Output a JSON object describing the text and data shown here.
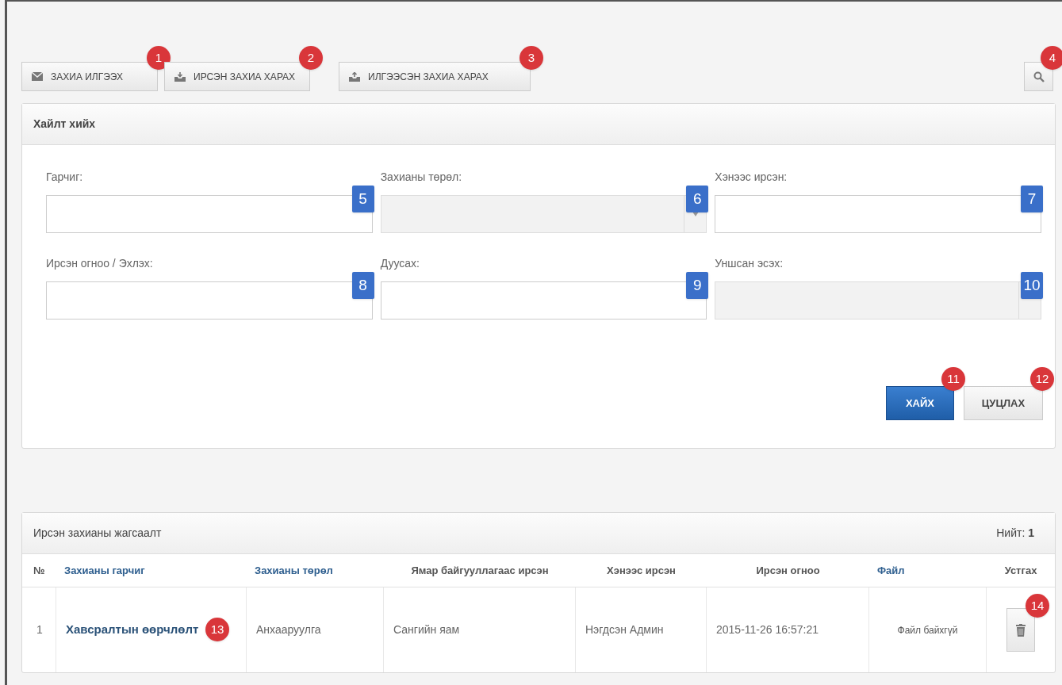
{
  "toolbar": [
    {
      "label": "ЗАХИА ИЛГЭЭХ",
      "marker": "1"
    },
    {
      "label": "ИРСЭН ЗАХИА ХАРАХ",
      "marker": "2"
    },
    {
      "label": "ИЛГЭЭСЭН ЗАХИА ХАРАХ",
      "marker": "3"
    }
  ],
  "search_toggle": {
    "marker": "4"
  },
  "search_panel": {
    "title": "Хайлт хийх",
    "fields": [
      {
        "label": "Гарчиг:",
        "kind": "text",
        "marker": "5"
      },
      {
        "label": "Захианы төрөл:",
        "kind": "select",
        "marker": "6"
      },
      {
        "label": "Хэнээс ирсэн:",
        "kind": "text",
        "marker": "7"
      },
      {
        "label": "Ирсэн огноо / Эхлэх:",
        "kind": "text",
        "marker": "8"
      },
      {
        "label": "Дуусах:",
        "kind": "text",
        "marker": "9"
      },
      {
        "label": "Уншсан эсэх:",
        "kind": "addon",
        "marker": "10"
      }
    ],
    "buttons": [
      {
        "label": "ХАЙХ",
        "kind": "primary",
        "marker": "11"
      },
      {
        "label": "ЦУЦЛАХ",
        "kind": "default",
        "marker": "12"
      }
    ]
  },
  "list_panel": {
    "title": "Ирсэн захианы жагсаалт",
    "total_label": "Нийт:",
    "total": "1",
    "columns": [
      {
        "label": "№",
        "sortable": false
      },
      {
        "label": "Захианы гарчиг",
        "sortable": true
      },
      {
        "label": "Захианы төрөл",
        "sortable": true
      },
      {
        "label": "Ямар байгууллагаас ирсэн",
        "sortable": false
      },
      {
        "label": "Хэнээс ирсэн",
        "sortable": false
      },
      {
        "label": "Ирсэн огноо",
        "sortable": false
      },
      {
        "label": "Файл",
        "sortable": true
      },
      {
        "label": "Устгах",
        "sortable": false
      }
    ],
    "rows": [
      {
        "cells": [
          "1",
          "Хавсралтын өөрчлөлт",
          "Анхааруулга",
          "Сангийн яам",
          "Нэгдсэн Админ",
          "2015-11-26 16:57:21",
          "Файл байхгүй"
        ],
        "title_marker": "13",
        "delete_marker": "14"
      }
    ]
  }
}
